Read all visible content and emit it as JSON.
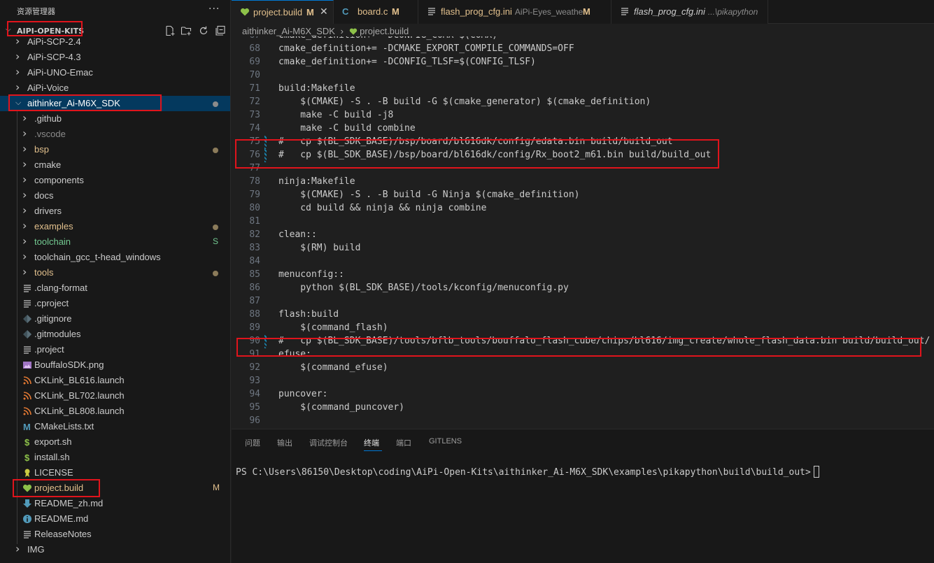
{
  "sidebar": {
    "title": "资源管理器",
    "more_label": "···",
    "workspace": "AIPI-OPEN-KITS",
    "items": [
      {
        "label": "AiPi-SCP-2.4",
        "type": "folder",
        "depth": 0,
        "expanded": false
      },
      {
        "label": "AiPi-SCP-4.3",
        "type": "folder",
        "depth": 0,
        "expanded": false
      },
      {
        "label": "AiPi-UNO-Emac",
        "type": "folder",
        "depth": 0,
        "expanded": false
      },
      {
        "label": "AiPi-Voice",
        "type": "folder",
        "depth": 0,
        "expanded": false
      },
      {
        "label": "aithinker_Ai-M6X_SDK",
        "type": "folder",
        "depth": 0,
        "expanded": true,
        "selected": true,
        "dot": "#8b8b8b"
      },
      {
        "label": ".github",
        "type": "folder",
        "depth": 1
      },
      {
        "label": ".vscode",
        "type": "folder",
        "depth": 1,
        "dim": true
      },
      {
        "label": "bsp",
        "type": "folder",
        "depth": 1,
        "color": "#e2c08d",
        "dot": "#8b7b5a"
      },
      {
        "label": "cmake",
        "type": "folder",
        "depth": 1
      },
      {
        "label": "components",
        "type": "folder",
        "depth": 1
      },
      {
        "label": "docs",
        "type": "folder",
        "depth": 1
      },
      {
        "label": "drivers",
        "type": "folder",
        "depth": 1
      },
      {
        "label": "examples",
        "type": "folder",
        "depth": 1,
        "color": "#e2c08d",
        "dot": "#8b7b5a"
      },
      {
        "label": "toolchain",
        "type": "folder",
        "depth": 1,
        "color": "#73c991",
        "badge": "S",
        "badge_color": "#73c991"
      },
      {
        "label": "toolchain_gcc_t-head_windows",
        "type": "folder",
        "depth": 1
      },
      {
        "label": "tools",
        "type": "folder",
        "depth": 1,
        "color": "#e2c08d",
        "dot": "#8b7b5a"
      },
      {
        "label": ".clang-format",
        "type": "file",
        "depth": 1,
        "icon": "lines-icon"
      },
      {
        "label": ".cproject",
        "type": "file",
        "depth": 1,
        "icon": "lines-icon"
      },
      {
        "label": ".gitignore",
        "type": "file",
        "depth": 1,
        "icon": "git-icon"
      },
      {
        "label": ".gitmodules",
        "type": "file",
        "depth": 1,
        "icon": "git-icon"
      },
      {
        "label": ".project",
        "type": "file",
        "depth": 1,
        "icon": "lines-icon"
      },
      {
        "label": "BouffaloSDK.png",
        "type": "file",
        "depth": 1,
        "icon": "image-icon"
      },
      {
        "label": "CKLink_BL616.launch",
        "type": "file",
        "depth": 1,
        "icon": "rss-icon"
      },
      {
        "label": "CKLink_BL702.launch",
        "type": "file",
        "depth": 1,
        "icon": "rss-icon"
      },
      {
        "label": "CKLink_BL808.launch",
        "type": "file",
        "depth": 1,
        "icon": "rss-icon"
      },
      {
        "label": "CMakeLists.txt",
        "type": "file",
        "depth": 1,
        "icon": "cmake-icon"
      },
      {
        "label": "export.sh",
        "type": "file",
        "depth": 1,
        "icon": "dollar-icon"
      },
      {
        "label": "install.sh",
        "type": "file",
        "depth": 1,
        "icon": "dollar-icon"
      },
      {
        "label": "LICENSE",
        "type": "file",
        "depth": 1,
        "icon": "license-icon"
      },
      {
        "label": "project.build",
        "type": "file",
        "depth": 1,
        "icon": "heart-icon",
        "color": "#e2c08d",
        "badge": "M",
        "badge_color": "#e2c08d"
      },
      {
        "label": "README_zh.md",
        "type": "file",
        "depth": 1,
        "icon": "download-icon"
      },
      {
        "label": "README.md",
        "type": "file",
        "depth": 1,
        "icon": "info-icon"
      },
      {
        "label": "ReleaseNotes",
        "type": "file",
        "depth": 1,
        "icon": "lines-icon"
      },
      {
        "label": "IMG",
        "type": "folder",
        "depth": 0,
        "expanded": false
      }
    ]
  },
  "tabs": [
    {
      "label": "project.build",
      "modified": "M",
      "icon": "heart-icon",
      "active": true,
      "color": "#e2c08d"
    },
    {
      "label": "board.c",
      "modified": "M",
      "icon": "c-icon",
      "color": "#e2c08d"
    },
    {
      "label": "flash_prog_cfg.ini",
      "description": "AiPi-Eyes_weather",
      "modified": "M",
      "icon": "lines-icon",
      "color": "#e2c08d"
    },
    {
      "label": "flash_prog_cfg.ini",
      "description": "...\\pikapython",
      "icon": "lines-icon",
      "italic": true,
      "color": "#cccccc"
    }
  ],
  "breadcrumb": {
    "folder": "aithinker_Ai-M6X_SDK",
    "separator": "›",
    "file": "project.build"
  },
  "editor": {
    "lines": [
      {
        "n": "67",
        "text": "cmake_definition+= -DCONFIG_COMX=$(COMX)"
      },
      {
        "n": "68",
        "text": "cmake_definition+= -DCMAKE_EXPORT_COMPILE_COMMANDS=OFF"
      },
      {
        "n": "69",
        "text": "cmake_definition+= -DCONFIG_TLSF=$(CONFIG_TLSF)"
      },
      {
        "n": "70",
        "text": ""
      },
      {
        "n": "71",
        "text": "build:Makefile"
      },
      {
        "n": "72",
        "text": "    $(CMAKE) -S . -B build -G $(cmake_generator) $(cmake_definition)"
      },
      {
        "n": "73",
        "text": "    make -C build -j8"
      },
      {
        "n": "74",
        "text": "    make -C build combine"
      },
      {
        "n": "75",
        "text": "#   cp $(BL_SDK_BASE)/bsp/board/bl616dk/config/edata.bin build/build_out",
        "modified": true
      },
      {
        "n": "76",
        "text": "#   cp $(BL_SDK_BASE)/bsp/board/bl616dk/config/Rx_boot2_m61.bin build/build_out",
        "modified": true
      },
      {
        "n": "77",
        "text": ""
      },
      {
        "n": "78",
        "text": "ninja:Makefile"
      },
      {
        "n": "79",
        "text": "    $(CMAKE) -S . -B build -G Ninja $(cmake_definition)"
      },
      {
        "n": "80",
        "text": "    cd build && ninja && ninja combine"
      },
      {
        "n": "81",
        "text": ""
      },
      {
        "n": "82",
        "text": "clean::"
      },
      {
        "n": "83",
        "text": "    $(RM) build"
      },
      {
        "n": "84",
        "text": ""
      },
      {
        "n": "85",
        "text": "menuconfig::"
      },
      {
        "n": "86",
        "text": "    python $(BL_SDK_BASE)/tools/kconfig/menuconfig.py"
      },
      {
        "n": "87",
        "text": ""
      },
      {
        "n": "88",
        "text": "flash:build"
      },
      {
        "n": "89",
        "text": "    $(command_flash)"
      },
      {
        "n": "90",
        "text": "#   cp $(BL_SDK_BASE)/tools/bflb_tools/bouffalo_flash_cube/chips/bl616/img_create/whole_flash_data.bin build/build_out/",
        "modified": true
      },
      {
        "n": "91",
        "text": "efuse:"
      },
      {
        "n": "92",
        "text": "    $(command_efuse)"
      },
      {
        "n": "93",
        "text": ""
      },
      {
        "n": "94",
        "text": "puncover:"
      },
      {
        "n": "95",
        "text": "    $(command_puncover)"
      },
      {
        "n": "96",
        "text": ""
      }
    ]
  },
  "panel": {
    "tabs": [
      "问题",
      "输出",
      "调试控制台",
      "终端",
      "端口",
      "GITLENS"
    ],
    "active_tab": "终端",
    "terminal_prompt": "PS C:\\Users\\86150\\Desktop\\coding\\AiPi-Open-Kits\\aithinker_Ai-M6X_SDK\\examples\\pikapython\\build\\build_out>"
  },
  "colors": {
    "accent": "#0078d4",
    "modified": "#e2c08d",
    "untracked": "#73c991",
    "highlight_box": "#e0141c"
  }
}
